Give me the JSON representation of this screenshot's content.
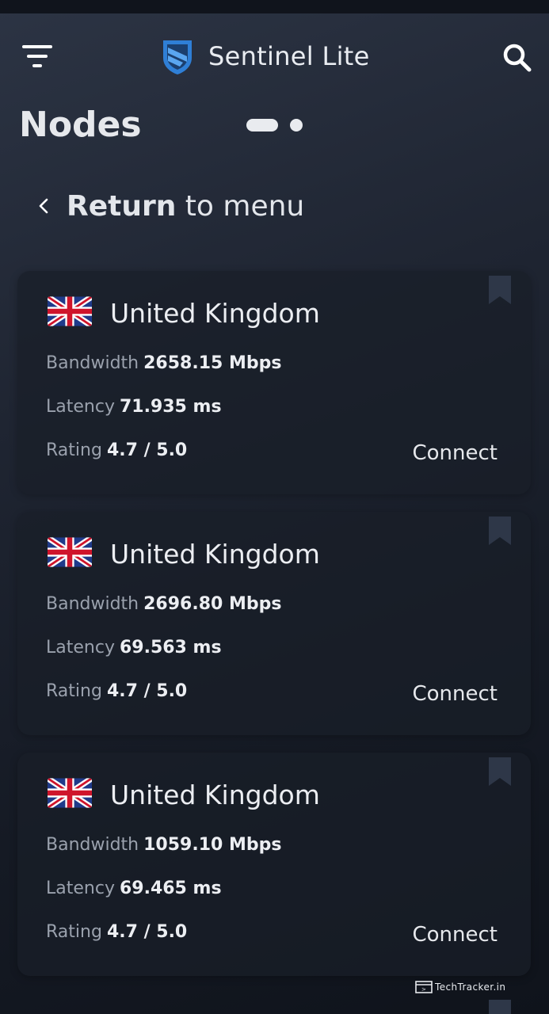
{
  "app": {
    "title": "Sentinel Lite",
    "accent_color": "#2f7fd6"
  },
  "header": {
    "menu_icon": "filter-menu-icon",
    "search_icon": "search-icon"
  },
  "page": {
    "title": "Nodes",
    "pager": {
      "count": 2,
      "active_index": 0
    }
  },
  "back": {
    "strong": "Return",
    "rest": " to menu"
  },
  "nodes": [
    {
      "country": "United Kingdom",
      "flag_icon": "uk-flag-icon",
      "bandwidth_label": "Bandwidth",
      "bandwidth_value": "2658.15 Mbps",
      "latency_label": "Latency",
      "latency_value": "71.935 ms",
      "rating_label": "Rating",
      "rating_value": "4.7 / 5.0",
      "connect_label": "Connect"
    },
    {
      "country": "United Kingdom",
      "flag_icon": "uk-flag-icon",
      "bandwidth_label": "Bandwidth",
      "bandwidth_value": "2696.80 Mbps",
      "latency_label": "Latency",
      "latency_value": "69.563 ms",
      "rating_label": "Rating",
      "rating_value": "4.7 / 5.0",
      "connect_label": "Connect"
    },
    {
      "country": "United Kingdom",
      "flag_icon": "uk-flag-icon",
      "bandwidth_label": "Bandwidth",
      "bandwidth_value": "1059.10 Mbps",
      "latency_label": "Latency",
      "latency_value": "69.465 ms",
      "rating_label": "Rating",
      "rating_value": "4.7 / 5.0",
      "connect_label": "Connect"
    }
  ],
  "watermark": {
    "text": "TechTracker.in"
  }
}
